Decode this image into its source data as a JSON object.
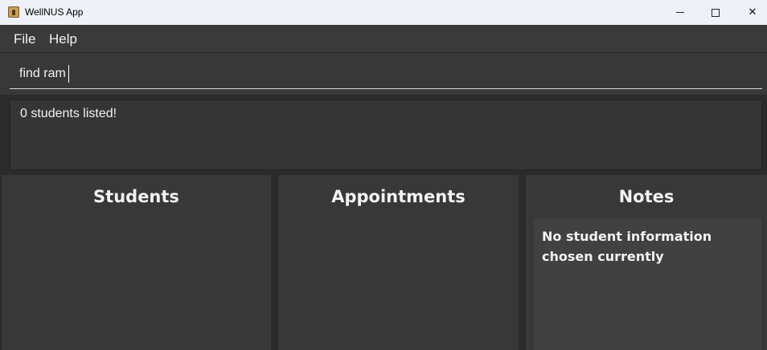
{
  "window": {
    "title": "WellNUS App",
    "minimize_icon": "minimize-icon",
    "maximize_icon": "maximize-icon",
    "close_icon": "close-icon",
    "close_glyph": "✕"
  },
  "menu": {
    "items": [
      {
        "label": "File"
      },
      {
        "label": "Help"
      }
    ]
  },
  "command": {
    "value": "find ram"
  },
  "result": {
    "text": "0 students listed!"
  },
  "panels": {
    "students": {
      "title": "Students"
    },
    "appointments": {
      "title": "Appointments"
    },
    "notes": {
      "title": "Notes",
      "placeholder": "No student information chosen currently"
    }
  },
  "colors": {
    "background": "#2b2b2b",
    "panel": "#383838",
    "notes_box": "#414141",
    "titlebar": "#eef1f8",
    "text": "#f2f2f2"
  }
}
